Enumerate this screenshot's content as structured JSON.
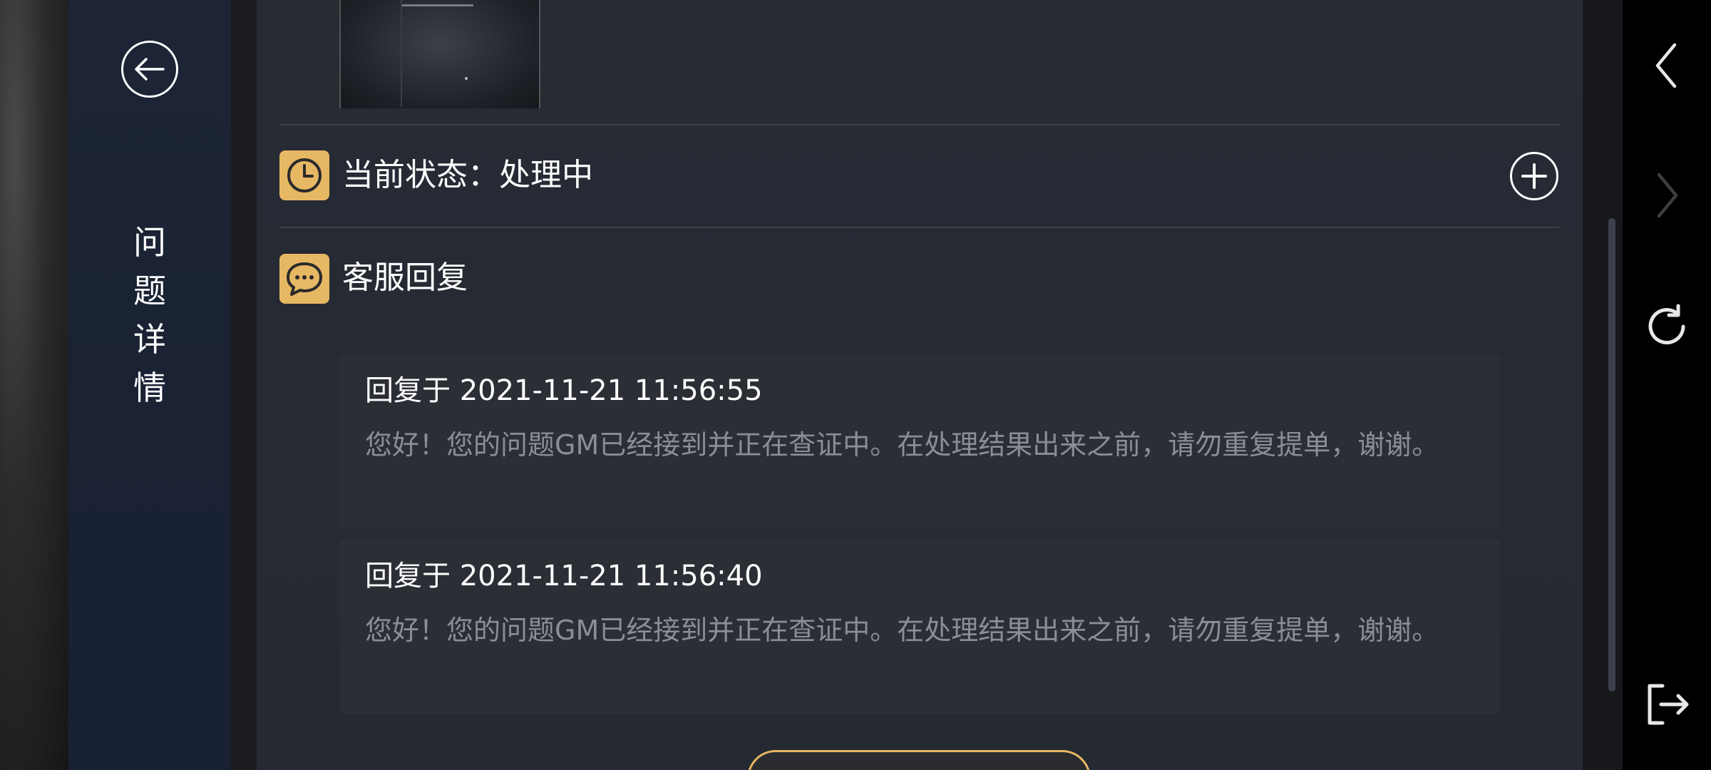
{
  "sidebar": {
    "title_chars": [
      "问",
      "题",
      "详",
      "情"
    ]
  },
  "status": {
    "label": "当前状态：处理中"
  },
  "replies_section": {
    "label": "客服回复",
    "items": [
      {
        "time": "回复于 2021-11-21 11:56:55",
        "message": "您好！您的问题GM已经接到并正在查证中。在处理结果出来之前，请勿重复提单，谢谢。"
      },
      {
        "time": "回复于 2021-11-21 11:56:40",
        "message": "您好！您的问题GM已经接到并正在查证中。在处理结果出来之前，请勿重复提单，谢谢。"
      }
    ]
  },
  "colors": {
    "accent": "#e7b863",
    "sidebar_bg": "#1c2435",
    "panel_bg": "#272b34",
    "card_bg": "#2b2e35",
    "muted_text": "#8b8e95"
  },
  "icons": {
    "back": "arrow-left-circle-icon",
    "status": "clock-icon",
    "replies": "chat-bubble-icon",
    "add": "plus-circle-icon",
    "nav_back": "chevron-left-icon",
    "nav_forward": "chevron-right-icon",
    "nav_refresh": "refresh-icon",
    "nav_exit": "exit-icon"
  }
}
